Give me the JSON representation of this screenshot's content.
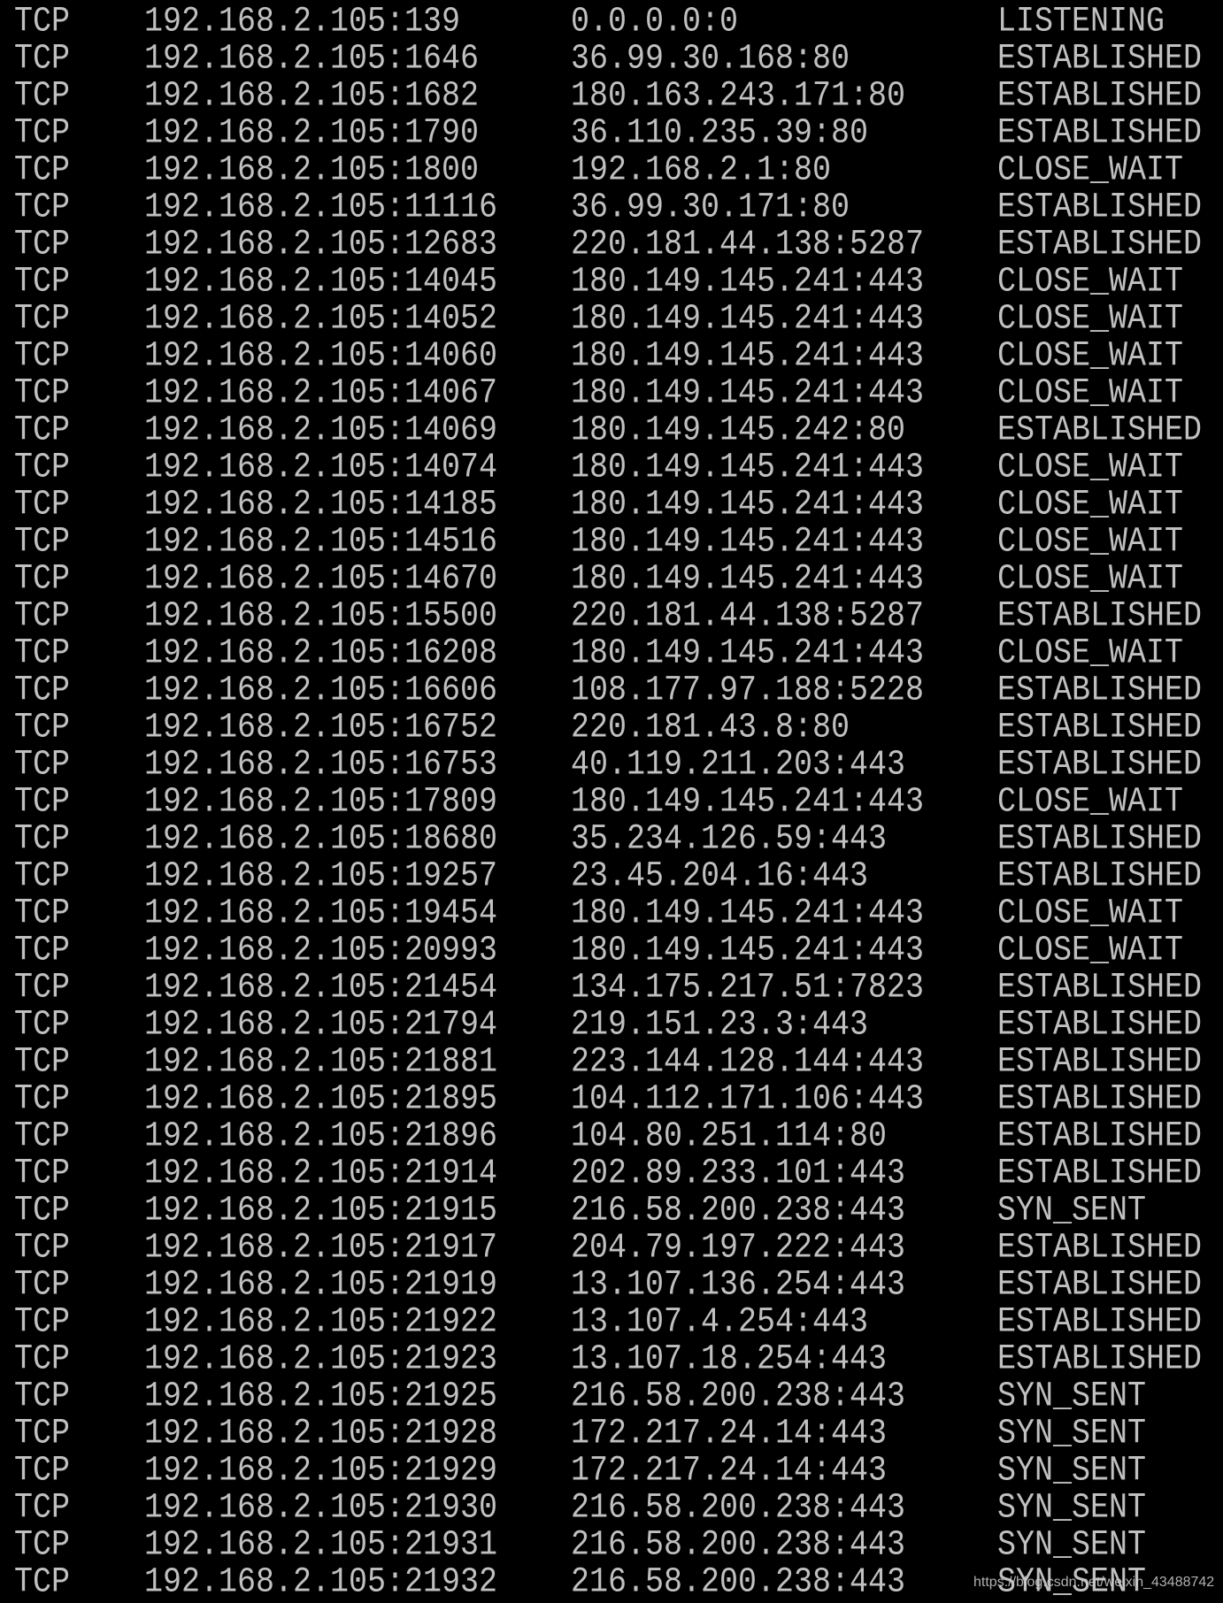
{
  "terminal": {
    "text_color": "#c0c0c0",
    "background": "#000000",
    "rows": [
      [
        "TCP",
        "192.168.2.105:139",
        "0.0.0.0:0",
        "LISTENING"
      ],
      [
        "TCP",
        "192.168.2.105:1646",
        "36.99.30.168:80",
        "ESTABLISHED"
      ],
      [
        "TCP",
        "192.168.2.105:1682",
        "180.163.243.171:80",
        "ESTABLISHED"
      ],
      [
        "TCP",
        "192.168.2.105:1790",
        "36.110.235.39:80",
        "ESTABLISHED"
      ],
      [
        "TCP",
        "192.168.2.105:1800",
        "192.168.2.1:80",
        "CLOSE_WAIT"
      ],
      [
        "TCP",
        "192.168.2.105:11116",
        "36.99.30.171:80",
        "ESTABLISHED"
      ],
      [
        "TCP",
        "192.168.2.105:12683",
        "220.181.44.138:5287",
        "ESTABLISHED"
      ],
      [
        "TCP",
        "192.168.2.105:14045",
        "180.149.145.241:443",
        "CLOSE_WAIT"
      ],
      [
        "TCP",
        "192.168.2.105:14052",
        "180.149.145.241:443",
        "CLOSE_WAIT"
      ],
      [
        "TCP",
        "192.168.2.105:14060",
        "180.149.145.241:443",
        "CLOSE_WAIT"
      ],
      [
        "TCP",
        "192.168.2.105:14067",
        "180.149.145.241:443",
        "CLOSE_WAIT"
      ],
      [
        "TCP",
        "192.168.2.105:14069",
        "180.149.145.242:80",
        "ESTABLISHED"
      ],
      [
        "TCP",
        "192.168.2.105:14074",
        "180.149.145.241:443",
        "CLOSE_WAIT"
      ],
      [
        "TCP",
        "192.168.2.105:14185",
        "180.149.145.241:443",
        "CLOSE_WAIT"
      ],
      [
        "TCP",
        "192.168.2.105:14516",
        "180.149.145.241:443",
        "CLOSE_WAIT"
      ],
      [
        "TCP",
        "192.168.2.105:14670",
        "180.149.145.241:443",
        "CLOSE_WAIT"
      ],
      [
        "TCP",
        "192.168.2.105:15500",
        "220.181.44.138:5287",
        "ESTABLISHED"
      ],
      [
        "TCP",
        "192.168.2.105:16208",
        "180.149.145.241:443",
        "CLOSE_WAIT"
      ],
      [
        "TCP",
        "192.168.2.105:16606",
        "108.177.97.188:5228",
        "ESTABLISHED"
      ],
      [
        "TCP",
        "192.168.2.105:16752",
        "220.181.43.8:80",
        "ESTABLISHED"
      ],
      [
        "TCP",
        "192.168.2.105:16753",
        "40.119.211.203:443",
        "ESTABLISHED"
      ],
      [
        "TCP",
        "192.168.2.105:17809",
        "180.149.145.241:443",
        "CLOSE_WAIT"
      ],
      [
        "TCP",
        "192.168.2.105:18680",
        "35.234.126.59:443",
        "ESTABLISHED"
      ],
      [
        "TCP",
        "192.168.2.105:19257",
        "23.45.204.16:443",
        "ESTABLISHED"
      ],
      [
        "TCP",
        "192.168.2.105:19454",
        "180.149.145.241:443",
        "CLOSE_WAIT"
      ],
      [
        "TCP",
        "192.168.2.105:20993",
        "180.149.145.241:443",
        "CLOSE_WAIT"
      ],
      [
        "TCP",
        "192.168.2.105:21454",
        "134.175.217.51:7823",
        "ESTABLISHED"
      ],
      [
        "TCP",
        "192.168.2.105:21794",
        "219.151.23.3:443",
        "ESTABLISHED"
      ],
      [
        "TCP",
        "192.168.2.105:21881",
        "223.144.128.144:443",
        "ESTABLISHED"
      ],
      [
        "TCP",
        "192.168.2.105:21895",
        "104.112.171.106:443",
        "ESTABLISHED"
      ],
      [
        "TCP",
        "192.168.2.105:21896",
        "104.80.251.114:80",
        "ESTABLISHED"
      ],
      [
        "TCP",
        "192.168.2.105:21914",
        "202.89.233.101:443",
        "ESTABLISHED"
      ],
      [
        "TCP",
        "192.168.2.105:21915",
        "216.58.200.238:443",
        "SYN_SENT"
      ],
      [
        "TCP",
        "192.168.2.105:21917",
        "204.79.197.222:443",
        "ESTABLISHED"
      ],
      [
        "TCP",
        "192.168.2.105:21919",
        "13.107.136.254:443",
        "ESTABLISHED"
      ],
      [
        "TCP",
        "192.168.2.105:21922",
        "13.107.4.254:443",
        "ESTABLISHED"
      ],
      [
        "TCP",
        "192.168.2.105:21923",
        "13.107.18.254:443",
        "ESTABLISHED"
      ],
      [
        "TCP",
        "192.168.2.105:21925",
        "216.58.200.238:443",
        "SYN_SENT"
      ],
      [
        "TCP",
        "192.168.2.105:21928",
        "172.217.24.14:443",
        "SYN_SENT"
      ],
      [
        "TCP",
        "192.168.2.105:21929",
        "172.217.24.14:443",
        "SYN_SENT"
      ],
      [
        "TCP",
        "192.168.2.105:21930",
        "216.58.200.238:443",
        "SYN_SENT"
      ],
      [
        "TCP",
        "192.168.2.105:21931",
        "216.58.200.238:443",
        "SYN_SENT"
      ],
      [
        "TCP",
        "192.168.2.105:21932",
        "216.58.200.238:443",
        "SYN_SENT"
      ]
    ]
  },
  "watermark": "https://blog.csdn.net/weixin_43488742"
}
